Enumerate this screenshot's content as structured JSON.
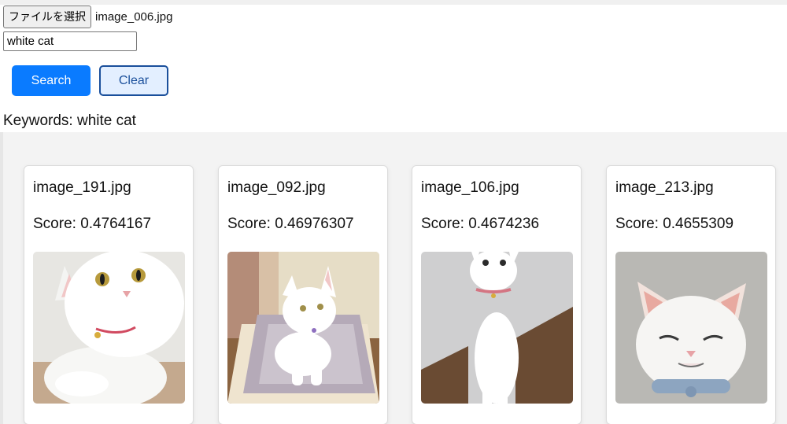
{
  "upload": {
    "button_label": "ファイルを選択",
    "file_name": "image_006.jpg"
  },
  "search": {
    "keyword_value": "white cat",
    "search_label": "Search",
    "clear_label": "Clear"
  },
  "keywords_line": "Keywords: white cat",
  "colors": {
    "search_button": "#0a7bff",
    "clear_button_border": "#1a4f9b",
    "clear_button_bg": "#e3efff"
  },
  "results": [
    {
      "name": "image_191.jpg",
      "score": "Score: 0.4764167",
      "thumb_icon": "white-cat-photo"
    },
    {
      "name": "image_092.jpg",
      "score": "Score: 0.46976307",
      "thumb_icon": "white-cat-photo"
    },
    {
      "name": "image_106.jpg",
      "score": "Score: 0.4674236",
      "thumb_icon": "white-cat-photo"
    },
    {
      "name": "image_213.jpg",
      "score": "Score: 0.4655309",
      "thumb_icon": "white-cat-photo"
    }
  ]
}
